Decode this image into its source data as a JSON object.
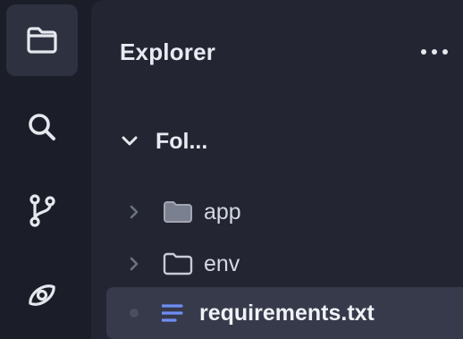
{
  "activity_bar": {
    "items": [
      {
        "icon": "folder-icon",
        "active": true
      },
      {
        "icon": "search-icon",
        "active": false
      },
      {
        "icon": "source-control-icon",
        "active": false
      },
      {
        "icon": "eye-icon",
        "active": false
      }
    ]
  },
  "sidebar": {
    "title": "Explorer",
    "more_icon": "ellipsis-icon",
    "root_folder": {
      "label": "Fol...",
      "expanded": true
    },
    "items": [
      {
        "label": "app",
        "type": "folder",
        "expanded": false
      },
      {
        "label": "env",
        "type": "folder",
        "expanded": false
      },
      {
        "label": "requirements.txt",
        "type": "file",
        "selected": true
      }
    ]
  },
  "colors": {
    "activity_bg": "#1b1e28",
    "sidebar_bg": "#232632",
    "active_item_bg": "#2e3240",
    "selected_row_bg": "#363a4a",
    "file_icon": "#6f8df5",
    "text": "#e8ebf2"
  }
}
